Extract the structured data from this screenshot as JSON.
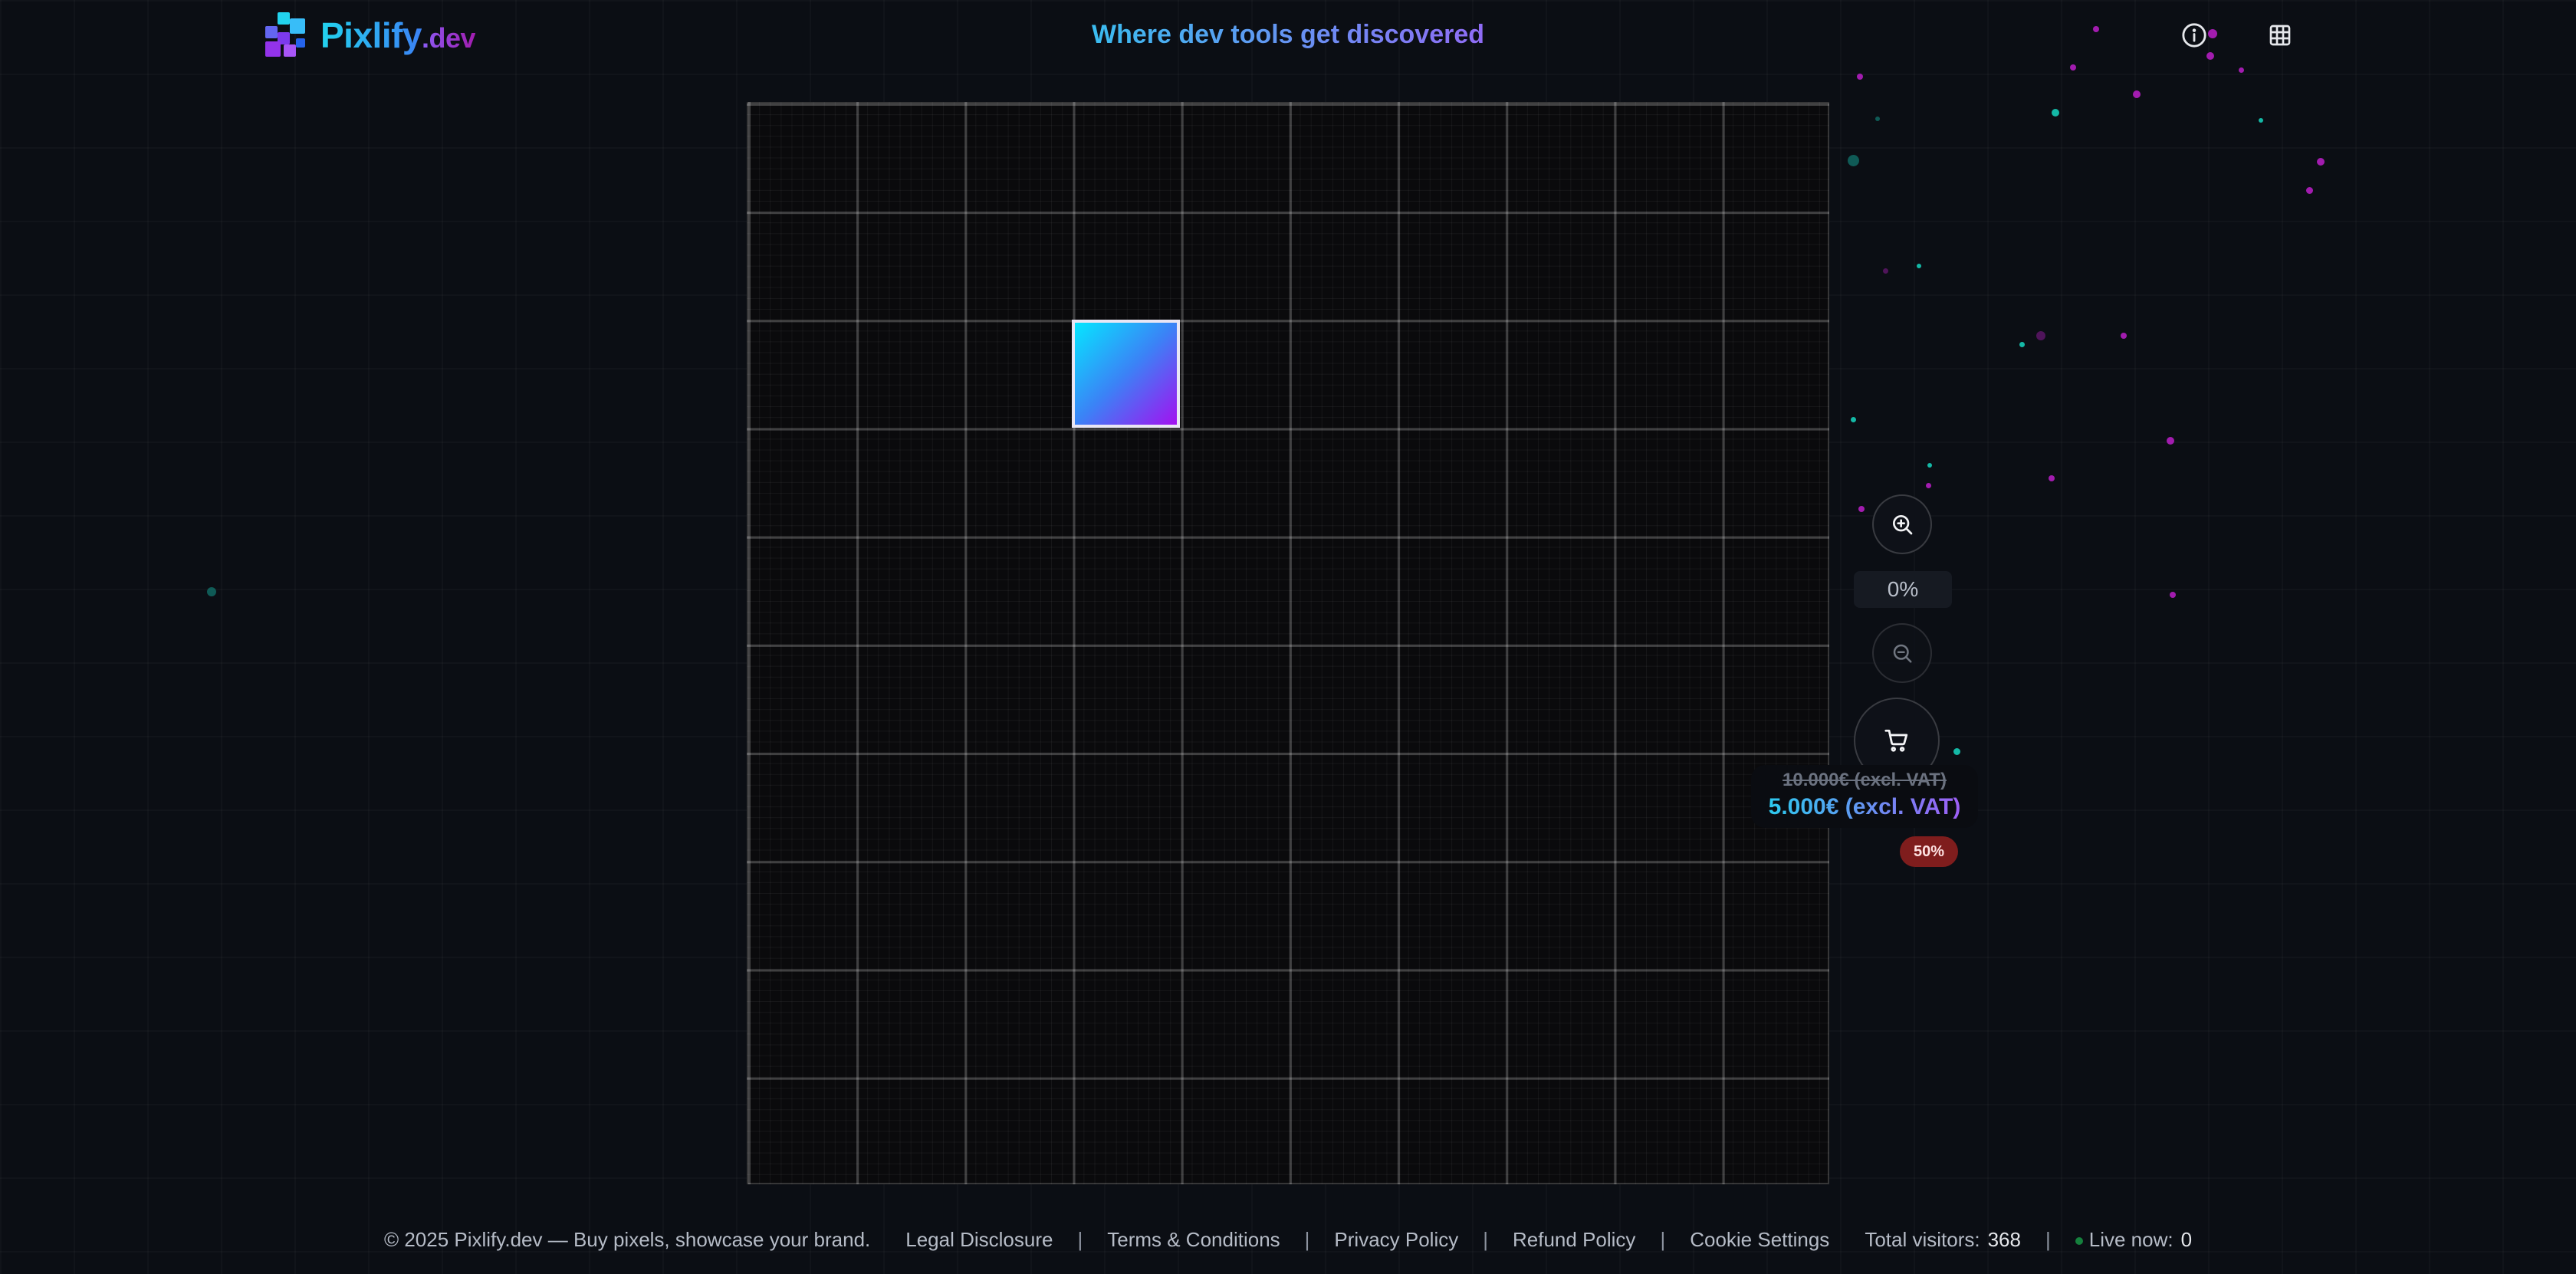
{
  "header": {
    "logo_main": "Pixlify",
    "logo_suffix": ".dev",
    "tagline": "Where dev tools get discovered",
    "info_icon": "info-icon",
    "grid_icon": "grid-icon"
  },
  "controls": {
    "zoom_in_icon": "zoom-in-icon",
    "zoom_level": "0%",
    "zoom_out_icon": "zoom-out-icon",
    "cart_icon": "cart-icon",
    "price_old": "10.000€ (excl. VAT)",
    "price_new": "5.000€ (excl. VAT)",
    "discount": "50%"
  },
  "footer": {
    "copyright": "© 2025 Pixlify.dev — Buy pixels, showcase your brand.",
    "links": [
      "Legal Disclosure",
      "Terms & Conditions",
      "Privacy Policy",
      "Refund Policy",
      "Cookie Settings"
    ],
    "separator": "|",
    "visitors_label": "Total visitors:",
    "visitors_count": "368",
    "live_label": "Live now:",
    "live_count": "0"
  },
  "colors": {
    "background": "#0b0e14",
    "accent_cyan": "#22d3ee",
    "accent_purple": "#a855f7",
    "discount_badge": "#7f1d1d"
  }
}
